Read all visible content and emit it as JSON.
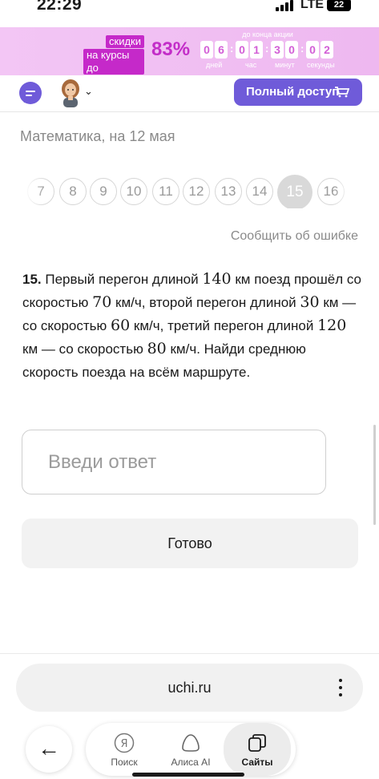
{
  "status_bar": {
    "time": "22:29",
    "network": "LTE",
    "battery": "22"
  },
  "promo": {
    "tag_line1": "скидки",
    "tag_line2": "на курсы до",
    "percent": "83%",
    "until_label": "до конца акции",
    "timer_digits": [
      "0",
      "6",
      "0",
      "1",
      "3",
      "0",
      "0",
      "2"
    ],
    "timer_labels": [
      "дней",
      "час",
      "минут",
      "секунды"
    ]
  },
  "header": {
    "full_access_label": "Полный доступ"
  },
  "subject": "Математика, на 12 мая",
  "pagination": {
    "pages": [
      "7",
      "8",
      "9",
      "10",
      "11",
      "12",
      "13",
      "14",
      "15",
      "16"
    ],
    "active": "15"
  },
  "report_error": "Сообщить об ошибке",
  "problem": {
    "number": "15.",
    "seg1": "Первый перегон длиной",
    "v140": "140",
    "seg2": "км поезд прошёл со скоростью",
    "v70": "70",
    "seg3": "км/ч, второй перегон длиной",
    "v30": "30",
    "seg4": "км — со скоростью",
    "v60": "60",
    "seg5": "км/ч, третий перегон длиной",
    "v120": "120",
    "seg6": "км — со скоростью",
    "v80": "80",
    "seg7": "км/ч. Найди среднюю скорость поезда на всём маршруте."
  },
  "answer": {
    "placeholder": "Введи ответ",
    "value": ""
  },
  "done_label": "Готово",
  "browser": {
    "url": "uchi.ru",
    "nav": [
      {
        "label": "Поиск",
        "icon": "yandex-icon"
      },
      {
        "label": "Алиса AI",
        "icon": "alice-icon"
      },
      {
        "label": "Сайты",
        "icon": "tabs-icon"
      }
    ],
    "active_nav": "Сайты"
  }
}
